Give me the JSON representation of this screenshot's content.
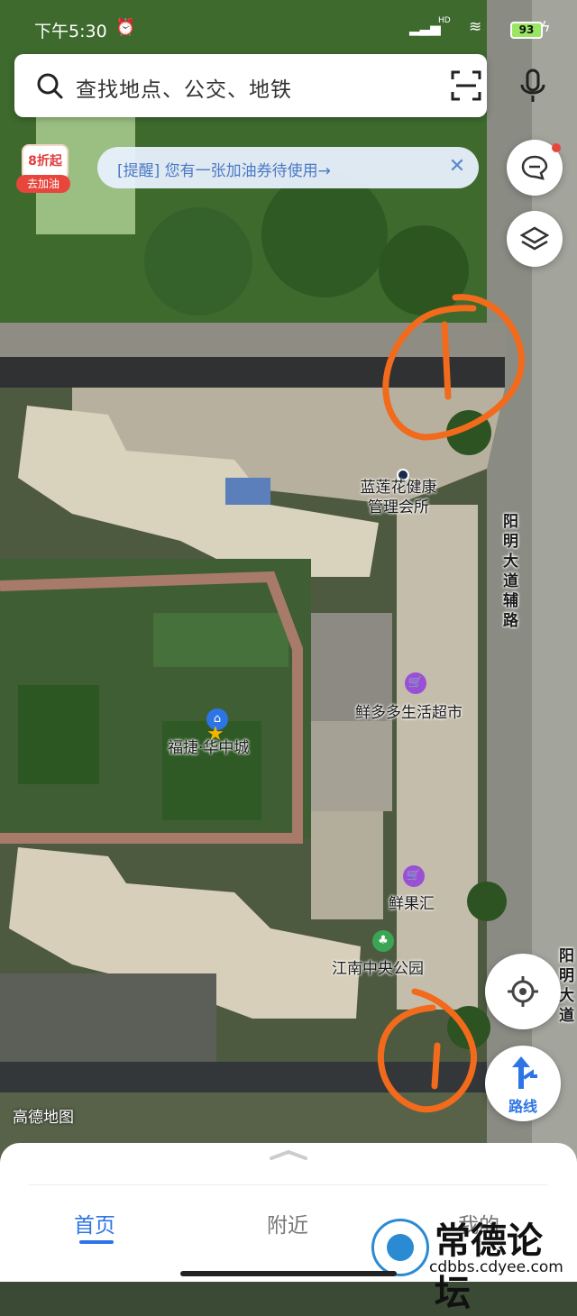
{
  "status_bar": {
    "time": "下午5:30",
    "network": "HD",
    "battery": "93"
  },
  "search": {
    "placeholder": "查找地点、公交、地铁"
  },
  "fuel_badge": {
    "discount": "8折起",
    "label": "去加油"
  },
  "notice": {
    "text": "[提醒] 您有一张加油券待使用→"
  },
  "map_labels": {
    "poi_clinic": "蓝莲花健康\n管理会所",
    "road_side": "阳明大道辅路",
    "poi_supermarket": "鲜多多生活超市",
    "poi_community": "福捷·华中城",
    "poi_fruit": "鲜果汇",
    "poi_park": "江南中央公园",
    "road_main": "阳明大道",
    "map_brand": "高德地图"
  },
  "route_button": {
    "label": "路线"
  },
  "tabs": [
    {
      "label": "首页",
      "active": true
    },
    {
      "label": "附近",
      "active": false
    },
    {
      "label": "我的",
      "active": false
    }
  ],
  "watermark": {
    "title": "常德论坛",
    "url": "cdbbs.cdyee.com"
  },
  "colors": {
    "accent": "#2d75e6",
    "annotation": "#f26a1b",
    "poi_purple": "#9b4fd6",
    "poi_green": "#3aa655"
  }
}
